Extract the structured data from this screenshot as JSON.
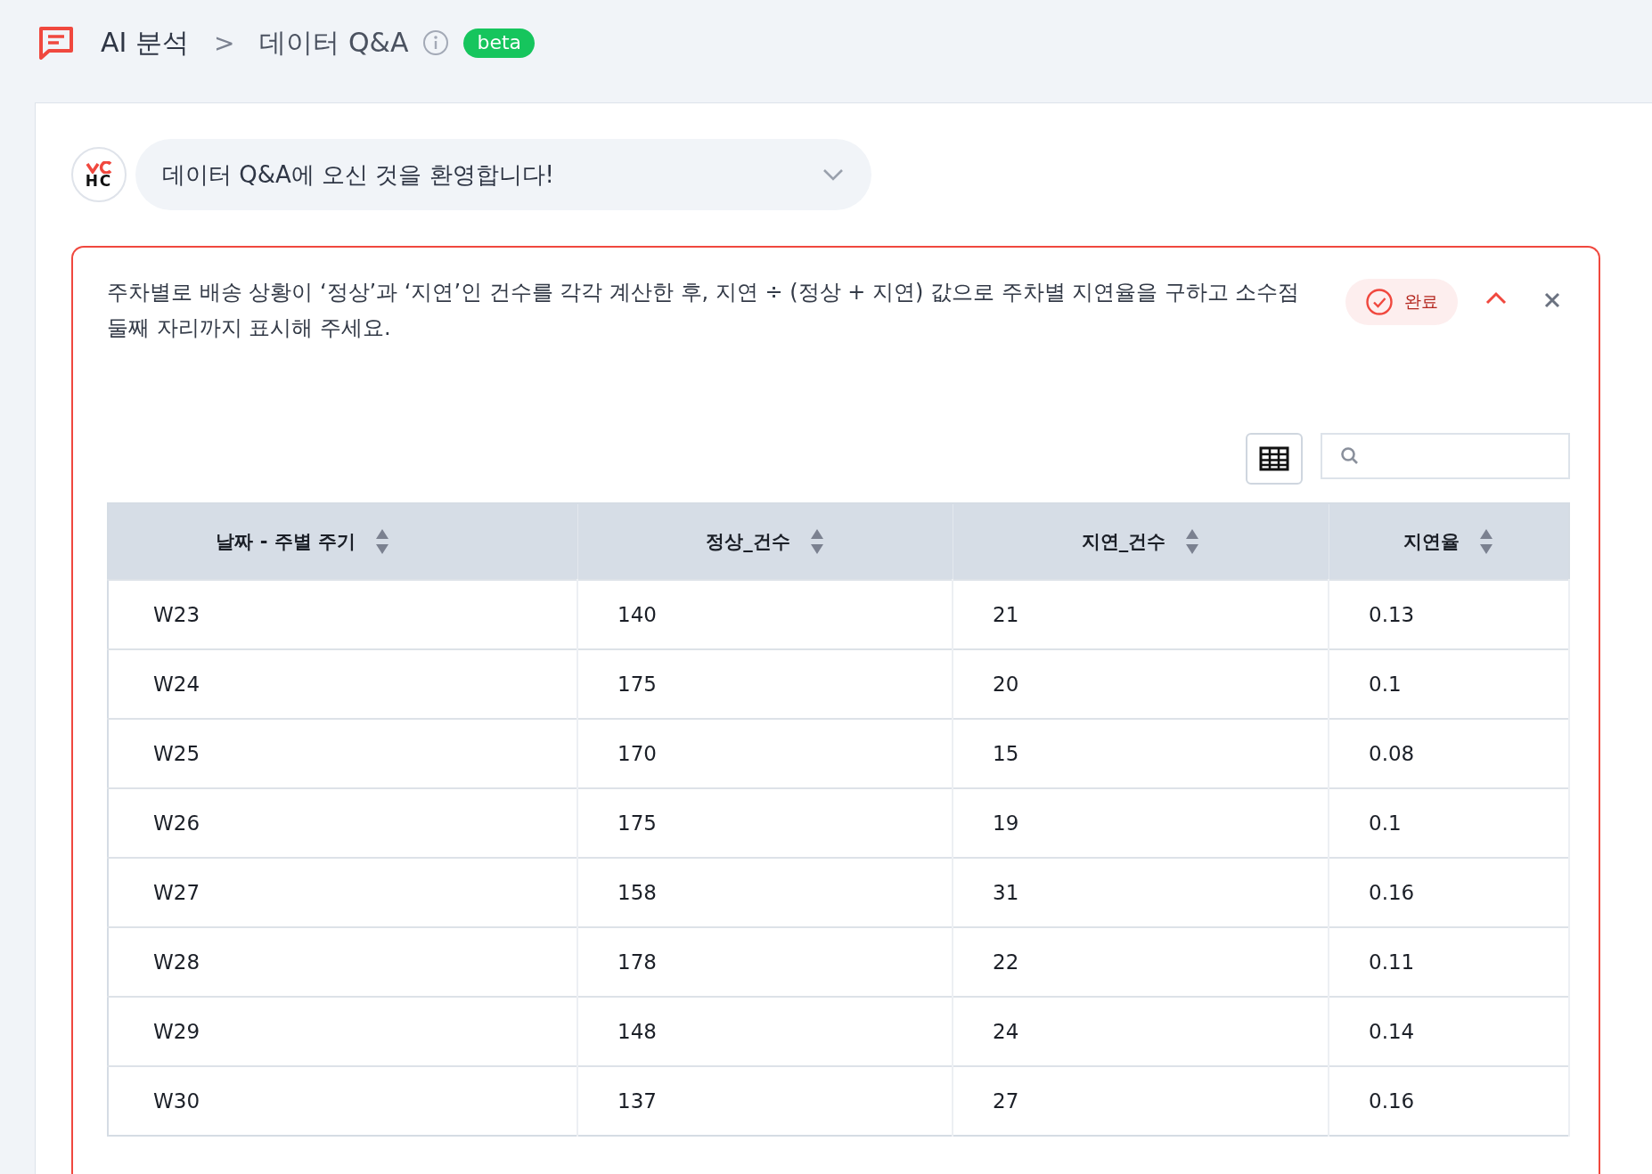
{
  "breadcrumb": {
    "section": "AI 분석",
    "separator": ">",
    "page": "데이터 Q&A",
    "badge": "beta"
  },
  "chat": {
    "avatar_text": "HC",
    "message": "데이터 Q&A에 오신 것을 환영합니다!",
    "expanded": false
  },
  "question": {
    "text": "주차별로 배송 상황이 ‘정상’과 ‘지연’인 건수를 각각 계산한 후, 지연 ÷ (정상 + 지연) 값으로 주차별 지연율을 구하고 소수점 둘째 자리까지 표시해 주세요.",
    "status": "완료",
    "expanded": true
  },
  "table": {
    "columns": [
      "날짜 - 주별 주기",
      "정상_건수",
      "지연_건수",
      "지연율"
    ],
    "rows": [
      [
        "W23",
        "140",
        "21",
        "0.13"
      ],
      [
        "W24",
        "175",
        "20",
        "0.1"
      ],
      [
        "W25",
        "170",
        "15",
        "0.08"
      ],
      [
        "W26",
        "175",
        "19",
        "0.1"
      ],
      [
        "W27",
        "158",
        "31",
        "0.16"
      ],
      [
        "W28",
        "178",
        "22",
        "0.11"
      ],
      [
        "W29",
        "148",
        "24",
        "0.14"
      ],
      [
        "W30",
        "137",
        "27",
        "0.16"
      ]
    ]
  }
}
